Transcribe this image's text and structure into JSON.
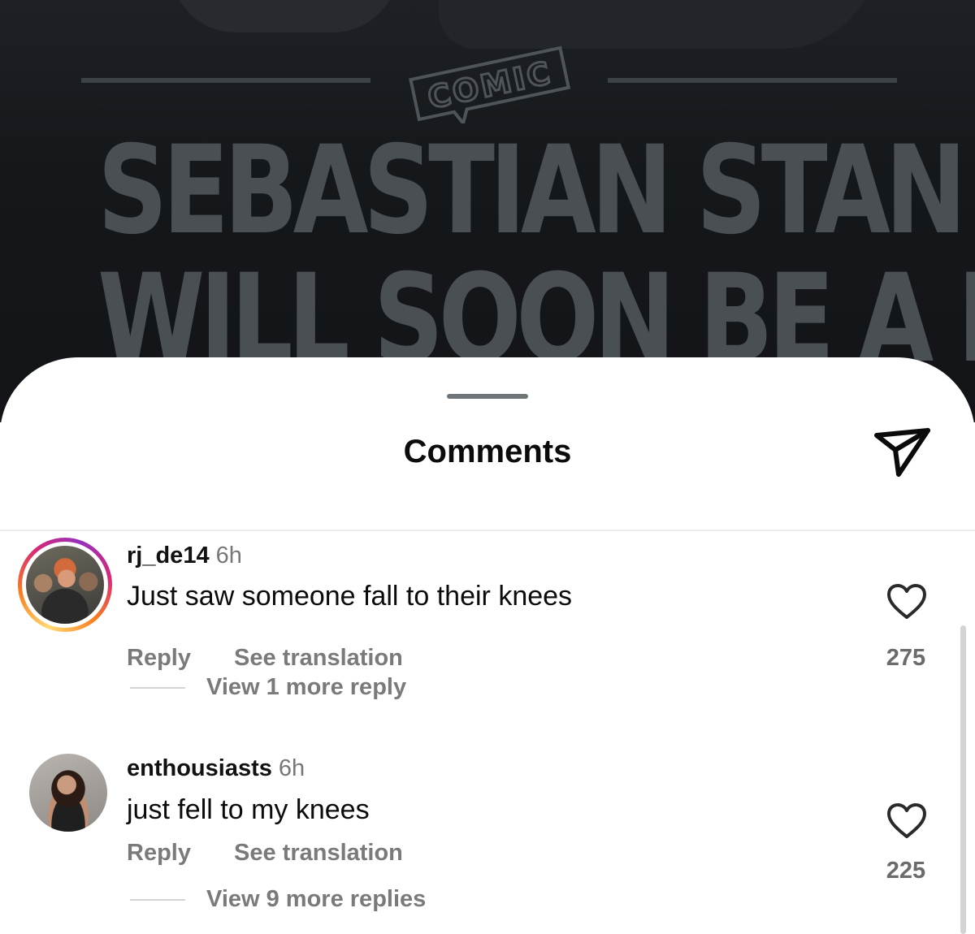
{
  "post": {
    "brand_logo_text": "COMIC",
    "headline_line1": "SEBASTIAN STAN",
    "headline_line2": "WILL SOON BE A DAD"
  },
  "sheet": {
    "title": "Comments",
    "share_icon": "paper-plane-icon"
  },
  "comments": [
    {
      "username": "rj_de14",
      "time": "6h",
      "text": "Just saw someone fall to their knees",
      "reply_label": "Reply",
      "translate_label": "See translation",
      "view_replies": "View 1 more reply",
      "likes": "275",
      "has_story_ring": true
    },
    {
      "username": "enthousiasts",
      "time": "6h",
      "text": "just fell to my knees",
      "reply_label": "Reply",
      "translate_label": "See translation",
      "view_replies": "View 9 more replies",
      "likes": "225",
      "has_story_ring": false
    }
  ],
  "colors": {
    "story_ring": [
      "#feda75",
      "#fa7e1e",
      "#d62976",
      "#962fbf"
    ],
    "post_background": "#15181b",
    "headline_text": "#4a4f53"
  }
}
